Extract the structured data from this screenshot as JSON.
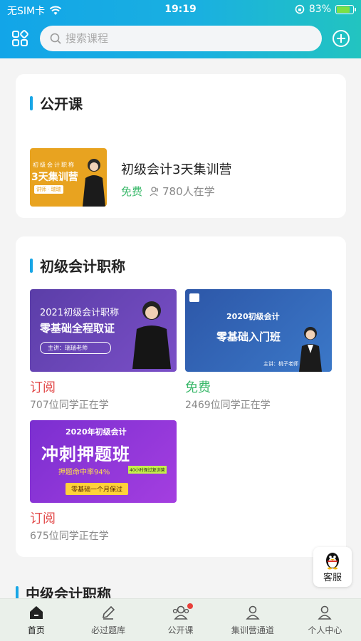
{
  "status_bar": {
    "carrier": "无SIM卡",
    "time": "19:19",
    "battery": "83%",
    "battery_level": 0.83
  },
  "search": {
    "placeholder": "搜索课程"
  },
  "sections": {
    "open_course": {
      "title": "公开课",
      "item": {
        "thumb_lines": [
          "初级会计职称",
          "3天集训营"
        ],
        "thumb_tag": "讲师 · 瑞瑞",
        "title": "初级会计3天集训营",
        "price": "免费",
        "students": "780人在学"
      }
    },
    "junior": {
      "title": "初级会计职称",
      "courses": [
        {
          "thumb_lines": [
            "2021初级会计职称",
            "零基础全程取证"
          ],
          "thumb_tag": "主讲：瑞瑞老师",
          "price": "订阅",
          "students": "707位同学正在学"
        },
        {
          "thumb_lines": [
            "2020初级会计",
            "零基础入门班"
          ],
          "thumb_tag": "主讲：桃子老师",
          "price": "免费",
          "students": "2469位同学正在学"
        },
        {
          "thumb_lines": [
            "2020年初级会计",
            "冲刺押题班",
            "押题命中率94%"
          ],
          "thumb_badge": "40小时保过复训营",
          "thumb_tag": "零基础一个月保过",
          "price": "订阅",
          "students": "675位同学正在学"
        }
      ]
    },
    "intermediate": {
      "title": "中级会计职称"
    }
  },
  "service": {
    "label": "客服"
  },
  "tabs": [
    {
      "label": "首页",
      "icon": "home-icon"
    },
    {
      "label": "必过题库",
      "icon": "pencil-icon"
    },
    {
      "label": "公开课",
      "icon": "group-icon"
    },
    {
      "label": "集训营通道",
      "icon": "user-icon"
    },
    {
      "label": "个人中心",
      "icon": "person-icon"
    }
  ],
  "colors": {
    "accent": "#18a6e6",
    "free": "#3ab86a",
    "subscribe": "#e24a4a"
  }
}
